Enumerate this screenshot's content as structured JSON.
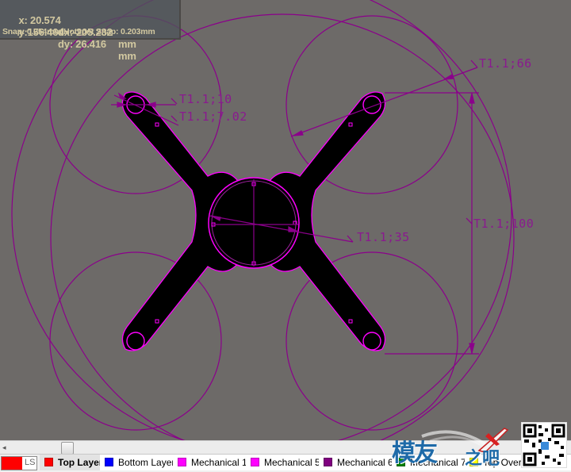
{
  "hud": {
    "x_label": "x: 20.574",
    "dx_label": "dx:-205.232",
    "dx_unit": "mm",
    "y_label": "y:156.464",
    "dy_label": "dy: 26.416",
    "dy_unit": "mm",
    "snap_label": "Snap: 0.254mm Hotspot Snap: 0.203mm"
  },
  "dimensions": {
    "d10": "T1.1;10",
    "d702": "T1.1;7.02",
    "d66": "T1.1;66",
    "d100": "T1.1;100",
    "d35": "T1.1;35"
  },
  "colors": {
    "canvas_bg": "#6d6a68",
    "board": "#000000",
    "outline": "#ff00ff",
    "mechanical": "#8b008b",
    "top_layer": "#ff0000",
    "bottom_layer": "#0000ff",
    "mechanical1": "#ff00ff",
    "mechanical5": "#ff00ff",
    "mechanical6": "#800080",
    "mechanical7": "#008000",
    "top_overlay": "#ffff00"
  },
  "layerbar": {
    "current_layer_label": "LS",
    "tabs": [
      {
        "label": "Top Layer",
        "color": "#ff0000",
        "active": true
      },
      {
        "label": "Bottom Layer",
        "color": "#0000ff",
        "active": false
      },
      {
        "label": "Mechanical 1",
        "color": "#ff00ff",
        "active": false
      },
      {
        "label": "Mechanical 5",
        "color": "#ff00ff",
        "active": false
      },
      {
        "label": "Mechanical 6",
        "color": "#800080",
        "active": false
      },
      {
        "label": "Mechanical 7",
        "color": "#008000",
        "active": false
      },
      {
        "label": "Top Overlay",
        "color": "#ffff00",
        "active": false
      }
    ]
  },
  "scrollbar": {
    "left_arrow": "◂"
  },
  "watermark": {
    "text_main": "模友",
    "text_sub": "之吧"
  }
}
